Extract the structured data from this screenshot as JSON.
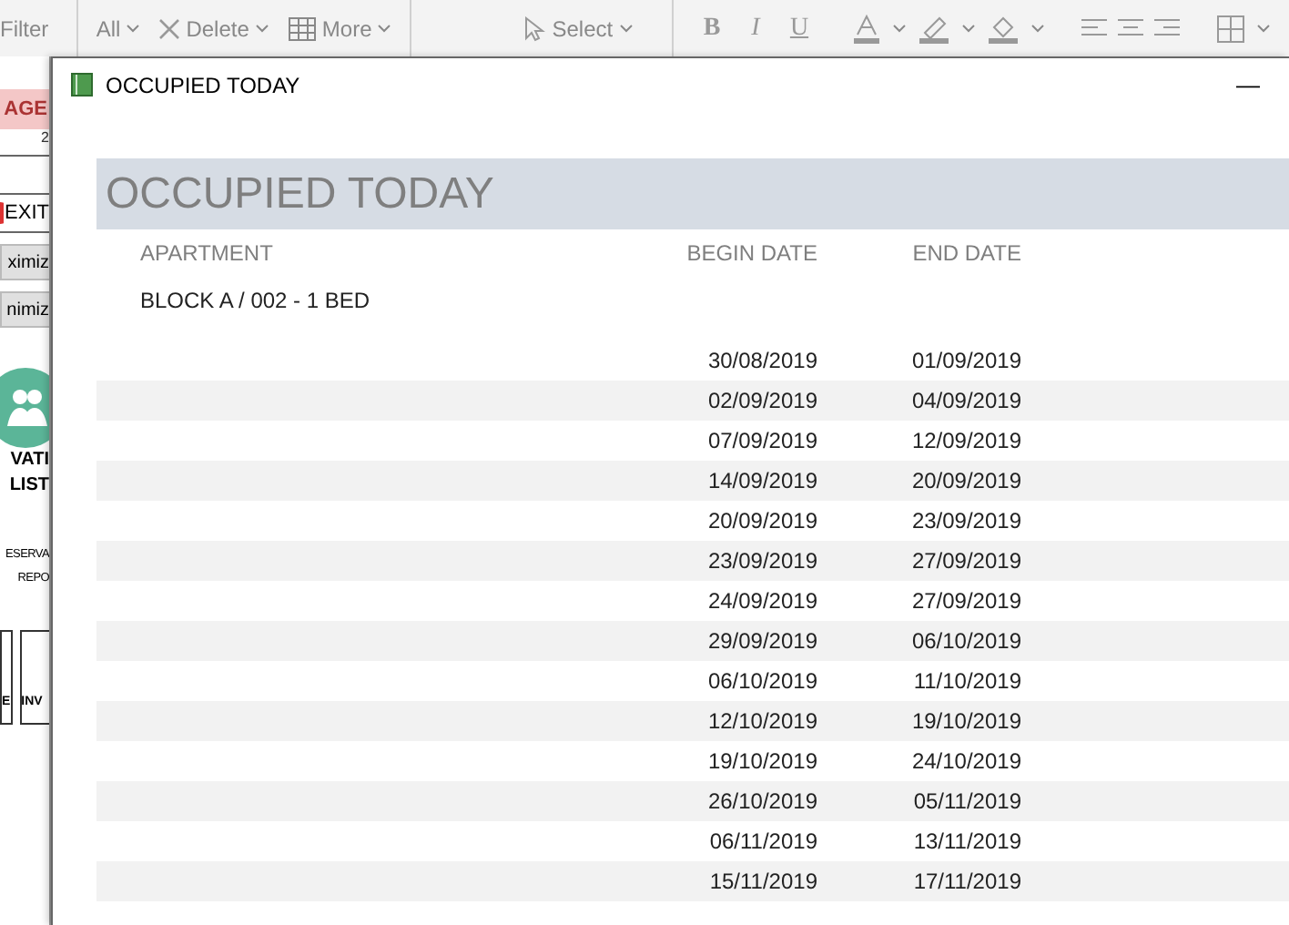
{
  "ribbon": {
    "filter": "Filter",
    "refresh": {
      "label": "All"
    },
    "delete": "Delete",
    "more": "More",
    "select": "Select",
    "format": [
      "B",
      "I",
      "U"
    ]
  },
  "sidebar": {
    "tab": "AGE",
    "ruler": "2",
    "exit": "EXIT",
    "buttons": [
      "ximiz",
      "nimiz"
    ],
    "tile": [
      "VATI",
      "LIST"
    ],
    "report": [
      "ESERVA",
      "REPO"
    ],
    "boxes": [
      "E",
      "INV"
    ]
  },
  "window": {
    "title": "OCCUPIED TODAY",
    "minimize": "—"
  },
  "report": {
    "title": "OCCUPIED TODAY",
    "columns": [
      "APARTMENT",
      "BEGIN DATE",
      "END DATE"
    ],
    "group": "BLOCK A / 002 - 1 BED",
    "rows": [
      {
        "begin": "30/08/2019",
        "end": "01/09/2019"
      },
      {
        "begin": "02/09/2019",
        "end": "04/09/2019"
      },
      {
        "begin": "07/09/2019",
        "end": "12/09/2019"
      },
      {
        "begin": "14/09/2019",
        "end": "20/09/2019"
      },
      {
        "begin": "20/09/2019",
        "end": "23/09/2019"
      },
      {
        "begin": "23/09/2019",
        "end": "27/09/2019"
      },
      {
        "begin": "24/09/2019",
        "end": "27/09/2019"
      },
      {
        "begin": "29/09/2019",
        "end": "06/10/2019"
      },
      {
        "begin": "06/10/2019",
        "end": "11/10/2019"
      },
      {
        "begin": "12/10/2019",
        "end": "19/10/2019"
      },
      {
        "begin": "19/10/2019",
        "end": "24/10/2019"
      },
      {
        "begin": "26/10/2019",
        "end": "05/11/2019"
      },
      {
        "begin": "06/11/2019",
        "end": "13/11/2019"
      },
      {
        "begin": "15/11/2019",
        "end": "17/11/2019"
      }
    ]
  }
}
